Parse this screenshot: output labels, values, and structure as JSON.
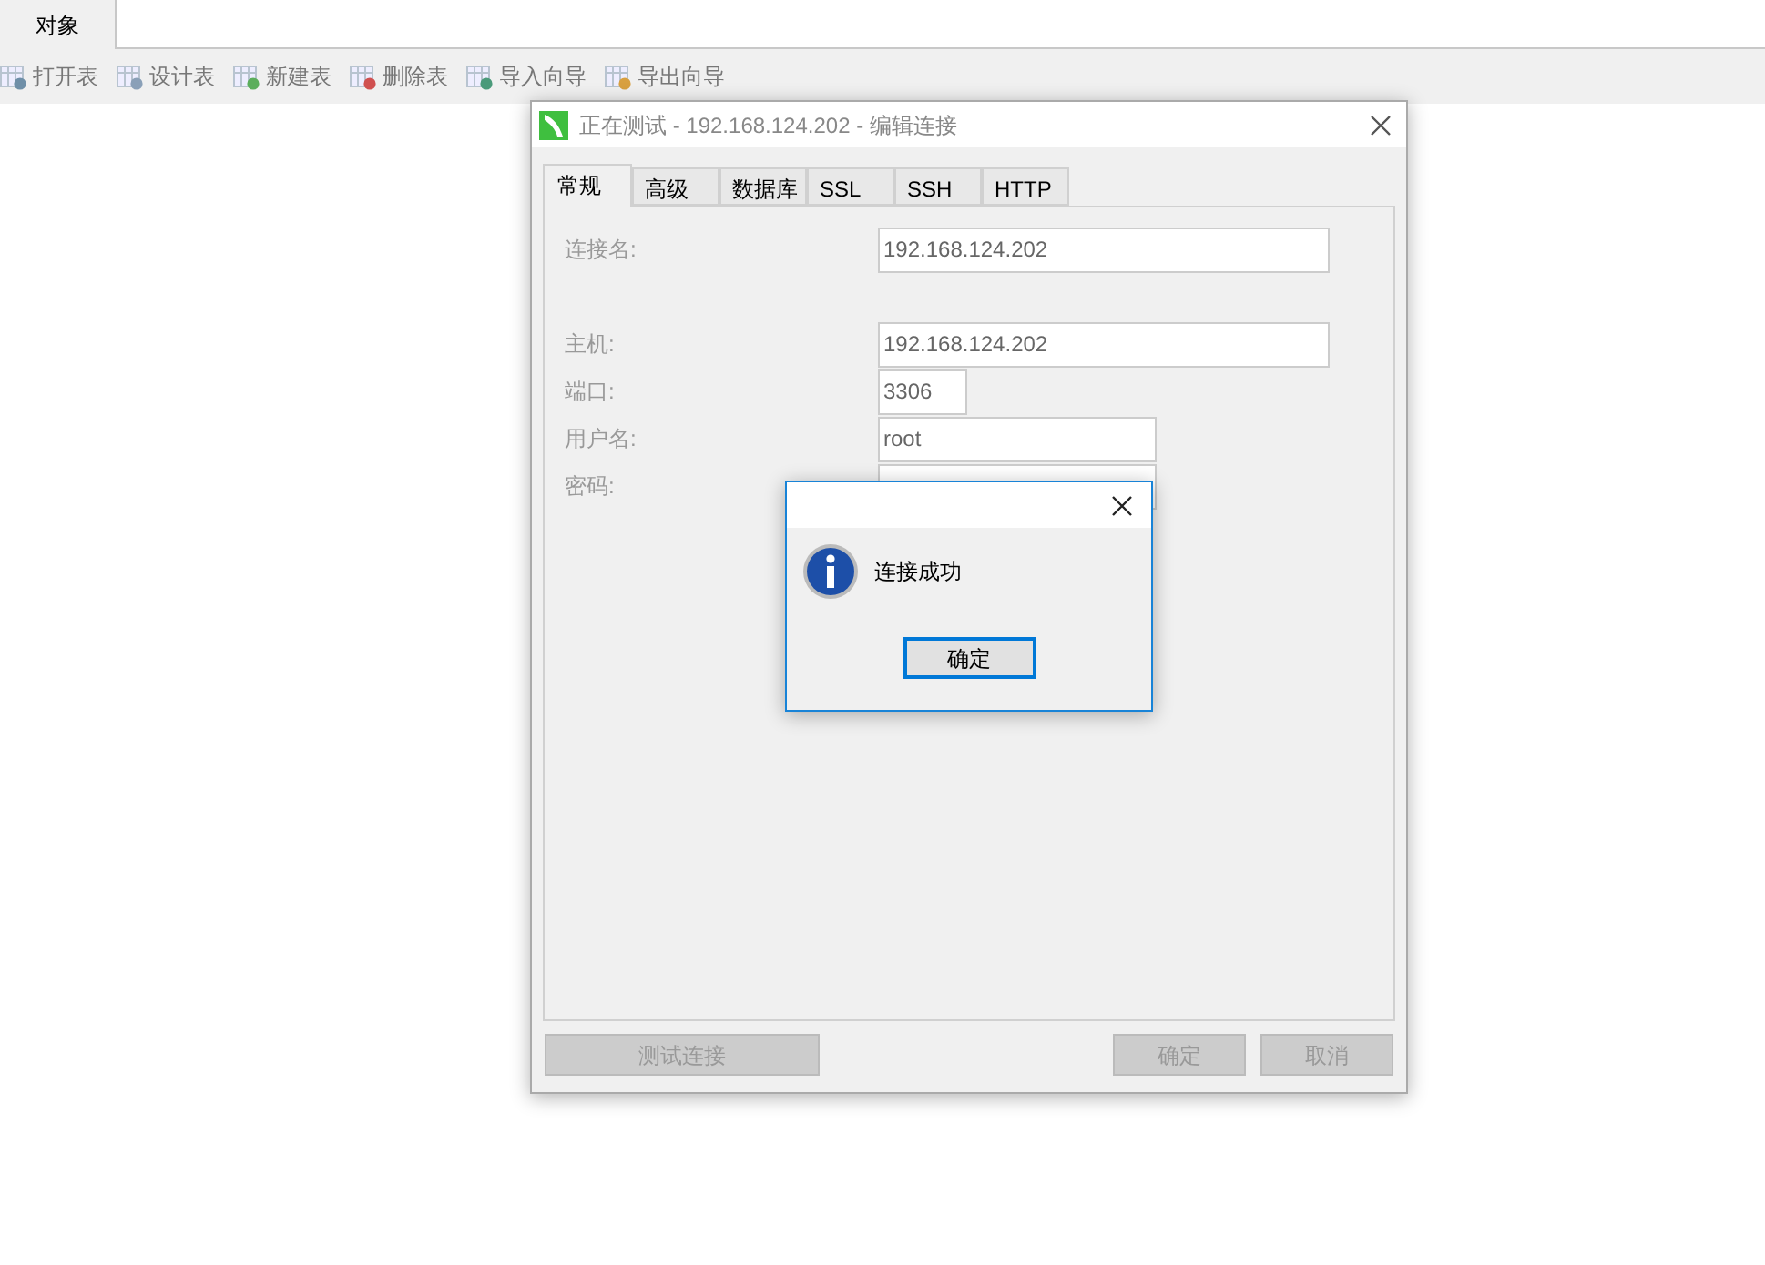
{
  "main_tabs": [
    {
      "label": "对象",
      "selected": true
    }
  ],
  "toolbar": [
    {
      "label": "打开表"
    },
    {
      "label": "设计表"
    },
    {
      "label": "新建表"
    },
    {
      "label": "删除表"
    },
    {
      "label": "导入向导"
    },
    {
      "label": "导出向导"
    }
  ],
  "dialog": {
    "title": "正在测试 - 192.168.124.202 - 编辑连接",
    "tabs": [
      {
        "label": "常规",
        "selected": true
      },
      {
        "label": "高级",
        "selected": false
      },
      {
        "label": "数据库",
        "selected": false
      },
      {
        "label": "SSL",
        "selected": false
      },
      {
        "label": "SSH",
        "selected": false
      },
      {
        "label": "HTTP",
        "selected": false
      }
    ],
    "fields": [
      {
        "label": "连接名:",
        "value": "192.168.124.202"
      },
      {
        "label": "主机:",
        "value": "192.168.124.202"
      },
      {
        "label": "端口:",
        "value": "3306"
      },
      {
        "label": "用户名:",
        "value": "root"
      },
      {
        "label": "密码:"
      }
    ],
    "test_button": "测试连接",
    "ok_button": "确定",
    "cancel_button": "取消"
  },
  "message_box": {
    "message": "连接成功",
    "ok_button": "确定"
  }
}
